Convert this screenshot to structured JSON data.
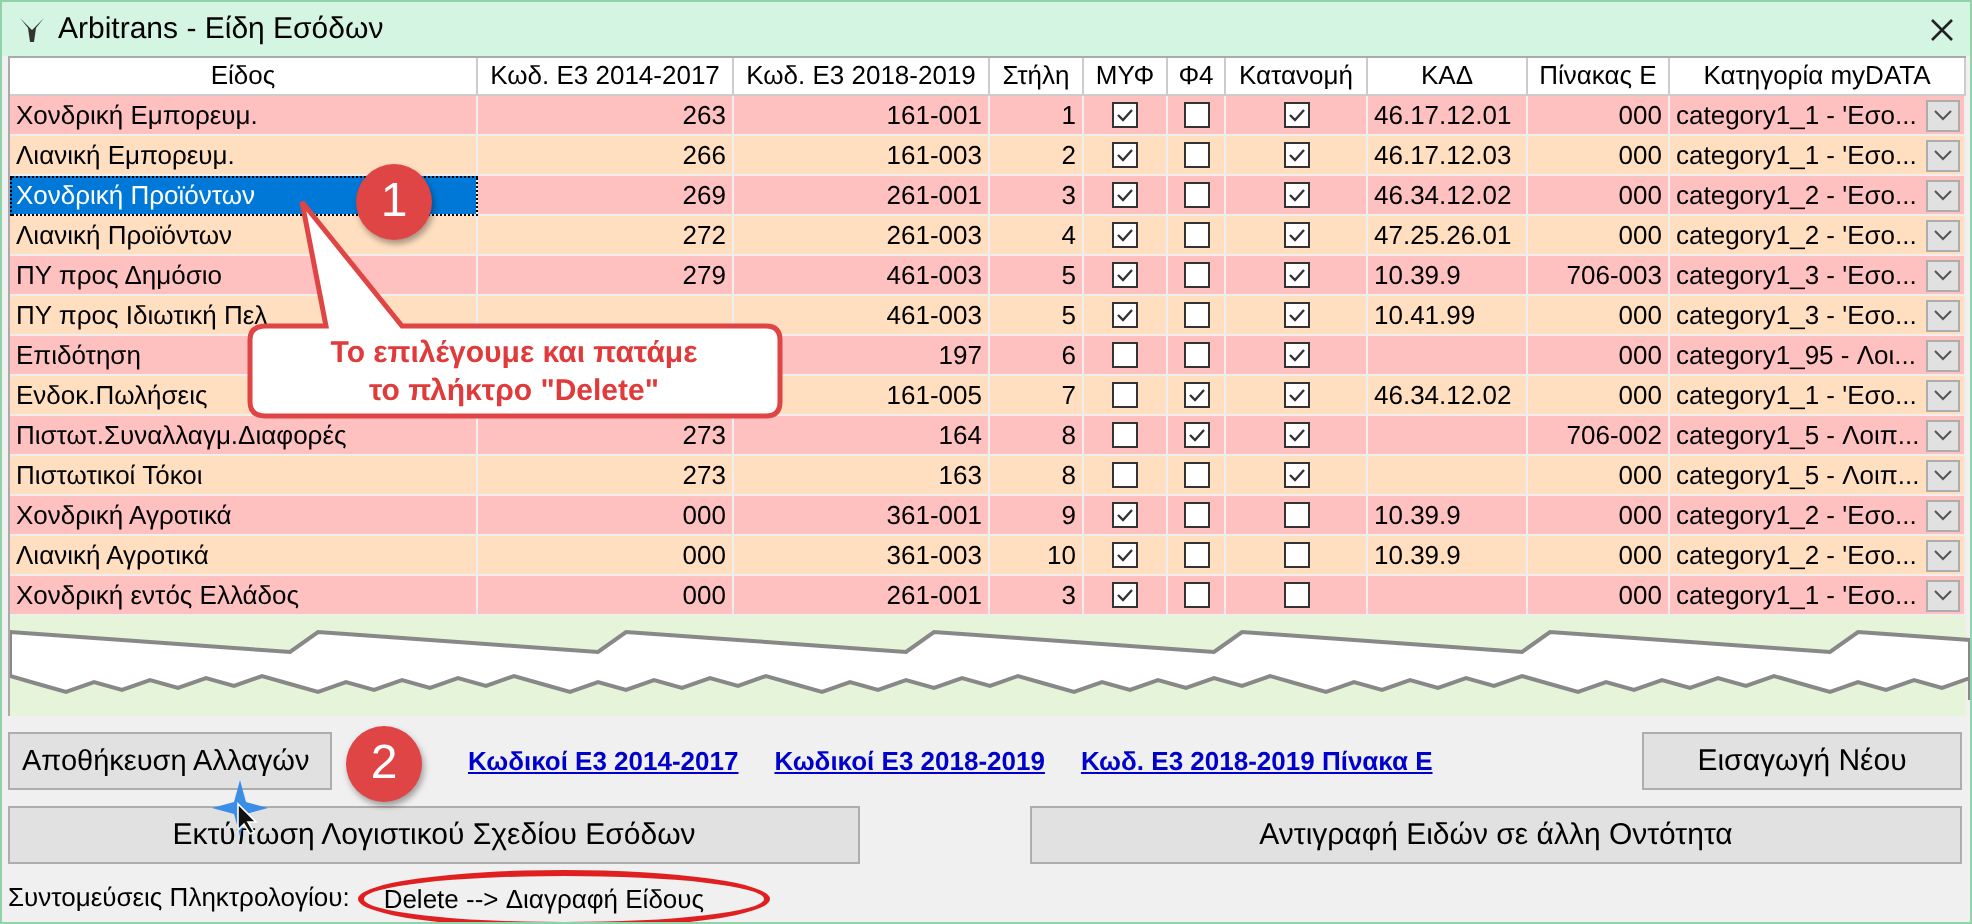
{
  "window": {
    "title": "Arbitrans - Είδη Εσόδων"
  },
  "table": {
    "columns": [
      "Είδος",
      "Κωδ. Ε3 2014-2017",
      "Κωδ. Ε3 2018-2019",
      "Στήλη",
      "ΜΥΦ",
      "Φ4",
      "Κατανομή",
      "ΚΑΔ",
      "Πίνακας Ε",
      "Κατηγορία myDATA"
    ],
    "rows": [
      {
        "name": "Χονδρική Εμπορευμ.",
        "code_2014": "263",
        "code_2018": "161-001",
        "column": "1",
        "myf": true,
        "f4": false,
        "allocation": true,
        "kad": "46.17.12.01",
        "table_e": "000",
        "category": "category1_1  - 'Εσο...",
        "selected": false
      },
      {
        "name": "Λιανική Εμπορευμ.",
        "code_2014": "266",
        "code_2018": "161-003",
        "column": "2",
        "myf": true,
        "f4": false,
        "allocation": true,
        "kad": "46.17.12.03",
        "table_e": "000",
        "category": "category1_1  - 'Εσο...",
        "selected": false
      },
      {
        "name": "Χονδρική Προϊόντων",
        "code_2014": "269",
        "code_2018": "261-001",
        "column": "3",
        "myf": true,
        "f4": false,
        "allocation": true,
        "kad": "46.34.12.02",
        "table_e": "000",
        "category": "category1_2  - 'Εσο...",
        "selected": true
      },
      {
        "name": "Λιανική Προϊόντων",
        "code_2014": "272",
        "code_2018": "261-003",
        "column": "4",
        "myf": true,
        "f4": false,
        "allocation": true,
        "kad": "47.25.26.01",
        "table_e": "000",
        "category": "category1_2  - 'Εσο...",
        "selected": false
      },
      {
        "name": "ΠΥ προς Δημόσιο",
        "code_2014": "279",
        "code_2018": "461-003",
        "column": "5",
        "myf": true,
        "f4": false,
        "allocation": true,
        "kad": "10.39.9",
        "table_e": "706-003",
        "category": "category1_3  - 'Εσο...",
        "selected": false
      },
      {
        "name": "ΠΥ προς Ιδιωτική Πελ",
        "code_2018": "461-003",
        "column": "5",
        "myf": true,
        "f4": false,
        "allocation": true,
        "kad": "10.41.99",
        "table_e": "000",
        "category": "category1_3  - 'Εσο...",
        "selected": false
      },
      {
        "name": "Επιδότηση",
        "code_2018": "197",
        "column": "6",
        "myf": false,
        "f4": false,
        "allocation": true,
        "table_e": "000",
        "category": "category1_95  - Λοι...",
        "selected": false
      },
      {
        "name": "Ενδοκ.Πωλήσεις",
        "code_2018": "161-005",
        "column": "7",
        "myf": false,
        "f4": true,
        "allocation": true,
        "kad": "46.34.12.02",
        "table_e": "000",
        "category": "category1_1  - 'Εσο...",
        "selected": false
      },
      {
        "name": "Πιστωτ.Συναλλαγμ.Διαφορές",
        "code_2014": "273",
        "code_2018": "164",
        "column": "8",
        "myf": false,
        "f4": true,
        "allocation": true,
        "table_e": "706-002",
        "category": "category1_5  - Λοιπ...",
        "selected": false
      },
      {
        "name": "Πιστωτικοί Τόκοι",
        "code_2014": "273",
        "code_2018": "163",
        "column": "8",
        "myf": false,
        "f4": false,
        "allocation": true,
        "table_e": "000",
        "category": "category1_5  - Λοιπ...",
        "selected": false
      },
      {
        "name": "Χονδρική Αγροτικά",
        "code_2014": "000",
        "code_2018": "361-001",
        "column": "9",
        "myf": true,
        "f4": false,
        "allocation": false,
        "kad": "10.39.9",
        "table_e": "000",
        "category": "category1_2  - 'Εσο...",
        "selected": false
      },
      {
        "name": "Λιανική Αγροτικά",
        "code_2014": "000",
        "code_2018": "361-003",
        "column": "10",
        "myf": true,
        "f4": false,
        "allocation": false,
        "kad": "10.39.9",
        "table_e": "000",
        "category": "category1_2  - 'Εσο...",
        "selected": false
      },
      {
        "name": "Χονδρική εντός Ελλάδος",
        "code_2014": "000",
        "code_2018": "261-001",
        "column": "3",
        "myf": true,
        "f4": false,
        "allocation": false,
        "table_e": "000",
        "category": "category1_1  - 'Εσο...",
        "selected": false
      }
    ]
  },
  "buttons": {
    "save": "Αποθήκευση Αλλαγών",
    "new": "Εισαγωγή Νέου",
    "print": "Εκτύπωση Λογιστικού Σχεδίου Εσόδων",
    "copy": "Αντιγραφή Ειδών σε άλλη Οντότητα"
  },
  "links": [
    "Κωδικοί Ε3 2014-2017",
    "Κωδικοί Ε3 2018-2019",
    "Κωδ. Ε3 2018-2019 Πίνακα Ε"
  ],
  "shortcuts": {
    "label": "Συντομεύσεις Πληκτρολογίου:",
    "keys": "Delete --> Διαγραφή Είδους"
  },
  "annotations": {
    "callout": "Το επιλέγουμε και πατάμε το πλήκτρο \"Delete\"",
    "badges": [
      "1",
      "2"
    ]
  }
}
